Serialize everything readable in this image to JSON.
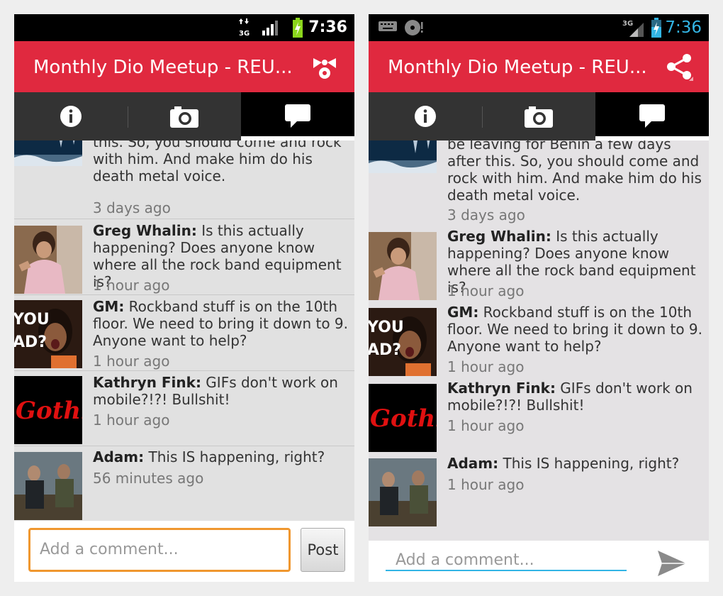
{
  "left": {
    "status_time": "7:36",
    "network": "3G",
    "title": "Monthly Dio Meetup - REU...",
    "comments": [
      {
        "text": "this. So, you should come and rock with him. And make him do his death metal voice.",
        "time": "3 days ago"
      },
      {
        "author": "Greg Whalin:",
        "text": " Is this actually happening?  Does anyone know where all the rock band equipment is?",
        "time": "1 hour ago"
      },
      {
        "author": "GM:",
        "text": " Rockband stuff is on the 10th floor. We need to bring it down to 9. Anyone want to help?",
        "time": "1 hour ago"
      },
      {
        "author": "Kathryn Fink:",
        "text": " GIFs don't work on mobile?!?! Bullshit!",
        "time": "1 hour ago"
      },
      {
        "author": "Adam:",
        "text": " This IS happening, right?",
        "time": "56 minutes ago"
      }
    ],
    "comment_placeholder": "Add a comment...",
    "post_label": "Post"
  },
  "right": {
    "status_time": "7:36",
    "network": "3G",
    "title": "Monthly Dio Meetup - REU...",
    "comments": [
      {
        "text": "be leaving for Benin a few days after this. So, you should come and rock with him. And make him do his death metal voice.",
        "time": "3 days ago"
      },
      {
        "author": "Greg Whalin:",
        "text": " Is this actually happening?  Does anyone know where all the rock band equipment is?",
        "time": "1 hour ago"
      },
      {
        "author": "GM:",
        "text": " Rockband stuff is on the 10th floor. We need to bring it down to 9. Anyone want to help?",
        "time": "1 hour ago"
      },
      {
        "author": "Kathryn Fink:",
        "text": " GIFs don't work on mobile?!?! Bullshit!",
        "time": "1 hour ago"
      },
      {
        "author": "Adam:",
        "text": " This IS happening, right?",
        "time": "1 hour ago"
      }
    ],
    "comment_placeholder": "Add a comment..."
  },
  "avatar_texts": {
    "oprah": "YOU AD?",
    "gothic": "Gothic"
  },
  "colors": {
    "action_bar": "#e0293f",
    "focus_orange": "#f0972f",
    "holo_blue": "#33b5e5"
  }
}
